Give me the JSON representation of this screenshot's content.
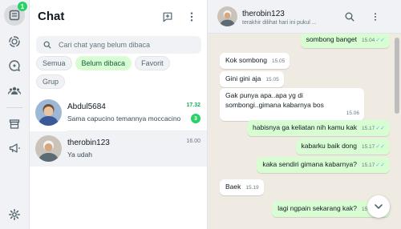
{
  "rail": {
    "chats_badge": "1",
    "icons": [
      "chats-icon",
      "status-icon",
      "channels-icon",
      "communities-icon",
      "store-icon",
      "megaphone-icon",
      "settings-icon"
    ]
  },
  "list": {
    "title": "Chat",
    "search_placeholder": "Cari chat yang belum dibaca",
    "filters": [
      "Semua",
      "Belum dibaca",
      "Favorit",
      "Grup"
    ],
    "active_filter": "Belum dibaca",
    "conversations": [
      {
        "name": "Abdul5684",
        "time": "17.32",
        "last_message": "Sama capucino temannya moccacino",
        "unread": "3"
      },
      {
        "name": "therobin123",
        "time": "16.00",
        "last_message": "Ya udah",
        "unread": ""
      }
    ]
  },
  "chat": {
    "contact_name": "therobin123",
    "status": "terakhir dilihat hari ini pukul ...",
    "messages": [
      {
        "dir": "out",
        "text": "sombong banget",
        "time": "15.04"
      },
      {
        "dir": "in",
        "text": "Kok sombong",
        "time": "15.05"
      },
      {
        "dir": "in",
        "text": "Gini gini aja",
        "time": "15.05"
      },
      {
        "dir": "in",
        "text": "Gak punya apa..apa yg di sombongi..gimana kabarnya bos",
        "time": "15.06"
      },
      {
        "dir": "out",
        "text": "habisnya ga keliatan nih kamu kak",
        "time": "15.17"
      },
      {
        "dir": "out",
        "text": "kabarku baik dong",
        "time": "15.17"
      },
      {
        "dir": "out",
        "text": "kaka sendiri gimana kabarnya?",
        "time": "15.17"
      },
      {
        "dir": "in",
        "text": "Baek",
        "time": "15.19"
      },
      {
        "dir": "out",
        "text": "lagi ngpain sekarang kak?",
        "time": "15.21"
      }
    ]
  },
  "colors": {
    "accent": "#25d366",
    "out_bubble": "#d9fdd3",
    "chat_bg": "#efeae2",
    "tick": "#53bdeb"
  }
}
